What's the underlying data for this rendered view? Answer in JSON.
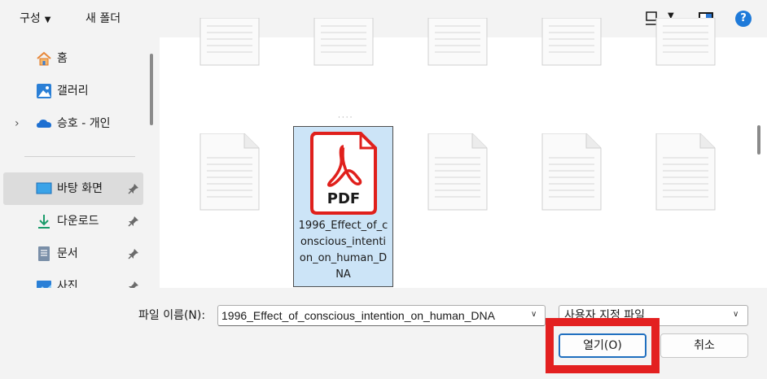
{
  "toolbar": {
    "organize_label": "구성",
    "new_folder_label": "새 폴더",
    "help_label": "?"
  },
  "nav": {
    "items": [
      {
        "label": "홈",
        "icon": "home-icon"
      },
      {
        "label": "갤러리",
        "icon": "gallery-icon"
      },
      {
        "label": "승호 - 개인",
        "icon": "onedrive-cloud-icon",
        "expandable": true
      },
      {
        "label": "바탕 화면",
        "icon": "desktop-icon",
        "pinned": true,
        "selected": true
      },
      {
        "label": "다운로드",
        "icon": "download-icon",
        "pinned": true
      },
      {
        "label": "문서",
        "icon": "document-icon",
        "pinned": true
      },
      {
        "label": "사진",
        "icon": "pictures-icon",
        "pinned": true
      }
    ]
  },
  "content": {
    "selected_file": {
      "name": "1996_Effect_of_conscious_intention_on_human_DNA",
      "icon_label": "PDF",
      "icon": "pdf-file-icon"
    },
    "colors": {
      "pdf_red": "#e0201c",
      "selection": "#cce4f7"
    }
  },
  "footer": {
    "filename_label": "파일 이름(N):",
    "filename_value": "1996_Effect_of_conscious_intention_on_human_DNA",
    "file_type": "사용자 지정 파일",
    "open_button": "열기(O)",
    "cancel_button": "취소",
    "highlight_color": "#e32020"
  }
}
